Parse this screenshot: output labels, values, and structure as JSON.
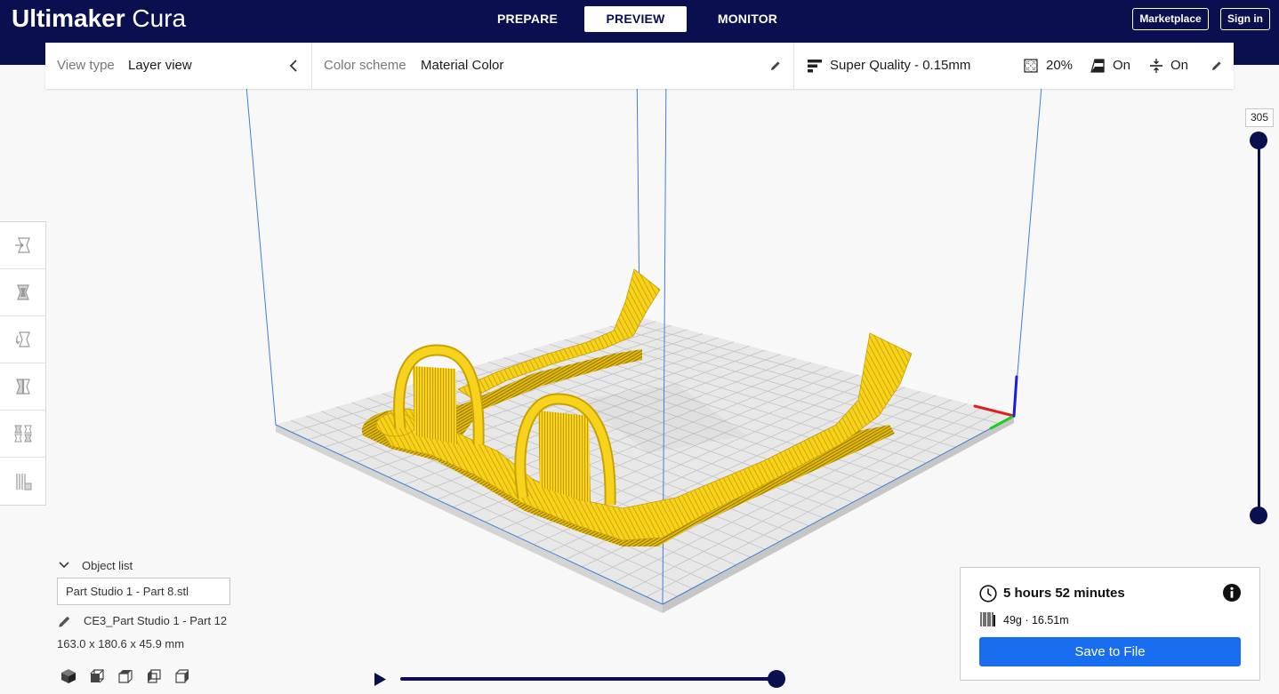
{
  "app": {
    "name_bold": "Ultimaker",
    "name_light": "Cura"
  },
  "header": {
    "tabs": [
      {
        "label": "PREPARE",
        "active": false
      },
      {
        "label": "PREVIEW",
        "active": true
      },
      {
        "label": "MONITOR",
        "active": false
      }
    ],
    "marketplace_label": "Marketplace",
    "sign_in_label": "Sign in"
  },
  "view_bar": {
    "view_type_label": "View type",
    "view_type_value": "Layer view",
    "color_scheme_label": "Color scheme",
    "color_scheme_value": "Material Color",
    "collapse_icon": "chevron-left-icon",
    "edit_icon": "pencil-icon"
  },
  "print_setup": {
    "profile": "Super Quality - 0.15mm",
    "infill": "20%",
    "support": "On",
    "adhesion": "On",
    "icons": {
      "profile": "quality-bars-icon",
      "infill": "infill-icon",
      "support": "support-icon",
      "adhesion": "adhesion-icon",
      "edit": "pencil-icon"
    }
  },
  "toolbar": {
    "tools": [
      {
        "icon": "move-tool-icon"
      },
      {
        "icon": "scale-tool-icon"
      },
      {
        "icon": "rotate-tool-icon"
      },
      {
        "icon": "mirror-tool-icon"
      },
      {
        "icon": "per-model-settings-icon"
      },
      {
        "icon": "support-blocker-icon"
      }
    ]
  },
  "layer_slider": {
    "upper_value": "305",
    "upper_position": 1,
    "lower_position": 0
  },
  "object_list": {
    "header": "Object list",
    "selected_file": "Part Studio 1 - Part 8.stl",
    "job_name": "CE3_Part Studio 1 - Part 12",
    "dimensions": "163.0 x 180.6 x 45.9 mm"
  },
  "view_orientation": {
    "buttons": [
      "3d-view-icon",
      "front-view-icon",
      "top-view-icon",
      "left-view-icon",
      "right-view-icon"
    ]
  },
  "simulation": {
    "play_icon": "play-icon",
    "progress": 1
  },
  "print_info": {
    "time": "5 hours 52 minutes",
    "material": "49g · 16.51m",
    "save_label": "Save to File",
    "icons": {
      "time": "clock-icon",
      "material": "filament-icon",
      "details": "info-icon"
    }
  },
  "colors": {
    "header_bg": "#0a0f50",
    "accent_blue": "#196ef0",
    "model_yellow": "#f7d31e",
    "build_volume_line": "#3d7fdc",
    "slider": "#0a0f50"
  }
}
